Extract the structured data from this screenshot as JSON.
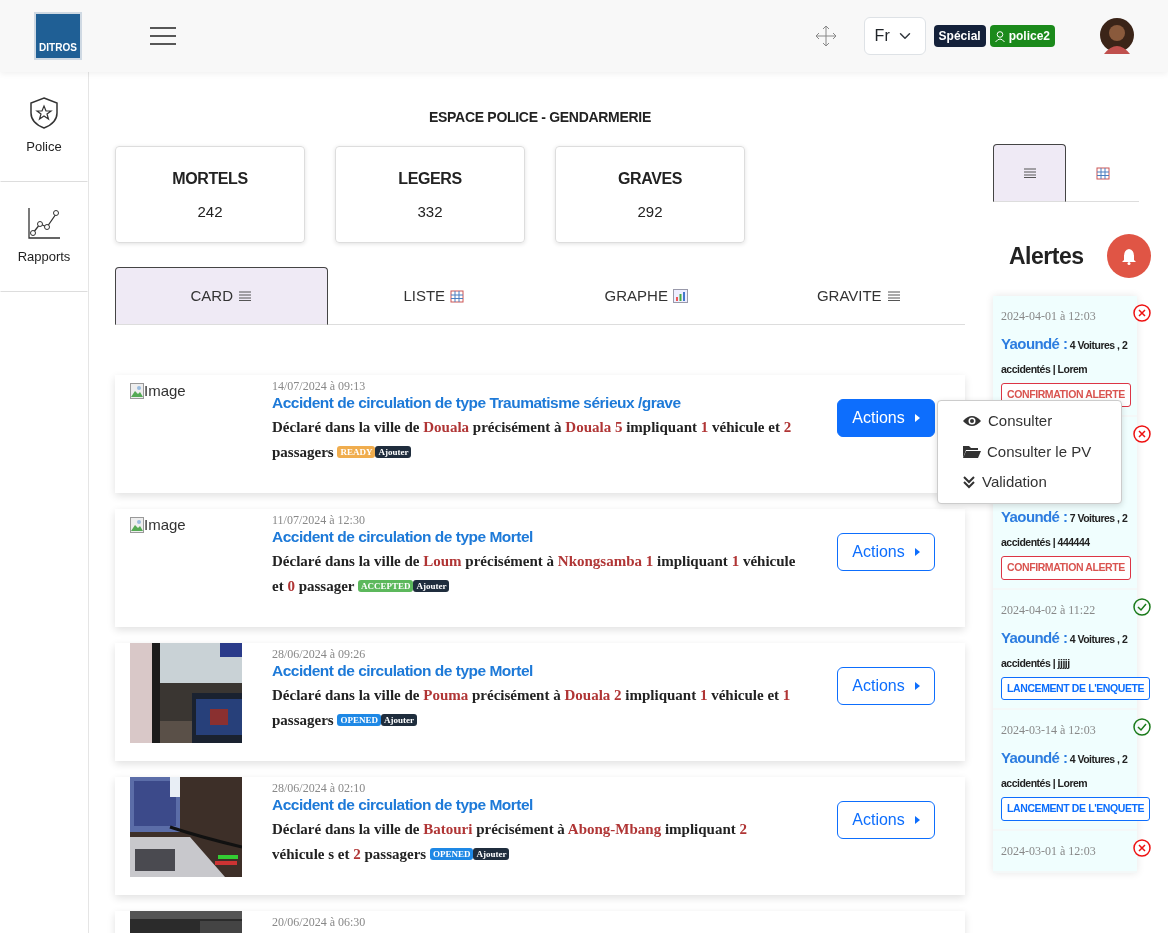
{
  "header": {
    "logo": "DITROS",
    "language": "Fr",
    "badges": [
      {
        "text": "Spécial",
        "kind": "role"
      },
      {
        "text": "police2",
        "kind": "user"
      }
    ]
  },
  "sidebar": {
    "items": [
      {
        "label": "Police",
        "kind": "police"
      },
      {
        "label": "Rapports",
        "kind": "reports"
      }
    ]
  },
  "page_title": "ESPACE POLICE - GENDARMERIE",
  "stats": [
    {
      "label": "MORTELS",
      "value": "242"
    },
    {
      "label": "LEGERS",
      "value": "332"
    },
    {
      "label": "GRAVES",
      "value": "292"
    }
  ],
  "tabs": [
    {
      "label": "CARD",
      "selected": true
    },
    {
      "label": "LISTE",
      "selected": false
    },
    {
      "label": "GRAPHE",
      "selected": false
    },
    {
      "label": "GRAVITE",
      "selected": false
    }
  ],
  "accidents": [
    {
      "image_alt": "Image",
      "date": "14/07/2024 à 09:13",
      "title": "Accident de circulation de type Traumatisme sérieux /grave",
      "description": [
        {
          "text": "Déclaré dans la ville de ",
          "highlight": false
        },
        {
          "text": "Douala",
          "highlight": true
        },
        {
          "text": " précisément à ",
          "highlight": false
        },
        {
          "text": "Douala 5",
          "highlight": true
        },
        {
          "text": " impliquant ",
          "highlight": false
        },
        {
          "text": "1",
          "highlight": true
        },
        {
          "text": " véhicule et ",
          "highlight": false
        },
        {
          "text": "2",
          "highlight": true
        },
        {
          "text": " passagers",
          "highlight": false
        }
      ],
      "status": {
        "text": "READY",
        "color": "#f0ad4e"
      },
      "add": "Ajouter",
      "actions": {
        "label": "Actions",
        "open": true,
        "menu": [
          {
            "label": "Consulter"
          },
          {
            "label": "Consulter le PV"
          },
          {
            "label": "Validation"
          }
        ]
      }
    },
    {
      "image_alt": "Image",
      "date": "11/07/2024 à 12:30",
      "title": "Accident de circulation de type Mortel",
      "description": [
        {
          "text": "Déclaré dans la ville de ",
          "highlight": false
        },
        {
          "text": "Loum",
          "highlight": true
        },
        {
          "text": " précisément à ",
          "highlight": false
        },
        {
          "text": "Nkongsamba 1",
          "highlight": true
        },
        {
          "text": " impliquant ",
          "highlight": false
        },
        {
          "text": "1",
          "highlight": true
        },
        {
          "text": " véhicule et ",
          "highlight": false
        },
        {
          "text": "0",
          "highlight": true
        },
        {
          "text": " passager",
          "highlight": false
        }
      ],
      "status": {
        "text": "ACCEPTED",
        "color": "#5cb85c"
      },
      "add": "Ajouter",
      "actions": {
        "label": "Actions",
        "open": false
      }
    },
    {
      "kind": "picture",
      "date": "28/06/2024 à 09:26",
      "title": "Accident de circulation de type Mortel",
      "description": [
        {
          "text": "Déclaré dans la ville de ",
          "highlight": false
        },
        {
          "text": "Pouma",
          "highlight": true
        },
        {
          "text": " précisément à ",
          "highlight": false
        },
        {
          "text": "Douala 2",
          "highlight": true
        },
        {
          "text": " impliquant ",
          "highlight": false
        },
        {
          "text": "1",
          "highlight": true
        },
        {
          "text": " véhicule et ",
          "highlight": false
        },
        {
          "text": "1",
          "highlight": true
        },
        {
          "text": " passagers",
          "highlight": false
        }
      ],
      "status": {
        "text": "OPENED",
        "color": "#1e88e5"
      },
      "add": "Ajouter",
      "actions": {
        "label": "Actions",
        "open": false
      }
    },
    {
      "kind": "picture",
      "date": "28/06/2024 à 02:10",
      "title": "Accident de circulation de type Mortel",
      "description": [
        {
          "text": "Déclaré dans la ville de ",
          "highlight": false
        },
        {
          "text": "Batouri",
          "highlight": true
        },
        {
          "text": " précisément à ",
          "highlight": false
        },
        {
          "text": "Abong-Mbang",
          "highlight": true
        },
        {
          "text": " impliquant ",
          "highlight": false
        },
        {
          "text": "2",
          "highlight": true
        },
        {
          "text": " véhicule s et ",
          "highlight": false
        },
        {
          "text": "2",
          "highlight": true
        },
        {
          "text": " passagers",
          "highlight": false
        }
      ],
      "status": {
        "text": "OPENED",
        "color": "#1e88e5"
      },
      "add": "Ajouter",
      "actions": {
        "label": "Actions",
        "open": false
      }
    },
    {
      "kind": "picture",
      "date": "20/06/2024 à 06:30"
    }
  ],
  "view_tabs": [
    {
      "selected": true
    },
    {
      "selected": false
    }
  ],
  "alerts": {
    "title": "Alertes",
    "items": [
      {
        "date": "2024-04-01 à 12:03",
        "resolved": false,
        "city": "Yaoundé :",
        "details": "4 Voitures , 2 accidentés | Lorem",
        "action": {
          "text": "CONFIRMATION ALERTE",
          "kind": "confirm"
        }
      },
      {
        "resolved": false,
        "city": "Yaoundé :",
        "details": "7 Voitures , 2 accidentés | 444444",
        "action": {
          "text": "CONFIRMATION ALERTE",
          "kind": "confirm"
        }
      },
      {
        "date": "2024-04-02 à 11:22",
        "resolved": true,
        "city": "Yaoundé :",
        "details": "4 Voitures , 2 accidentés | jjjjj",
        "action": {
          "text": "LANCEMENT DE L'ENQUETE",
          "kind": "launch"
        }
      },
      {
        "date": "2024-03-14 à 12:03",
        "resolved": true,
        "city": "Yaoundé :",
        "details": "4 Voitures , 2 accidentés | Lorem",
        "action": {
          "text": "LANCEMENT DE L'ENQUETE",
          "kind": "launch"
        }
      },
      {
        "date": "2024-03-01 à 12:03",
        "resolved": false
      }
    ]
  }
}
